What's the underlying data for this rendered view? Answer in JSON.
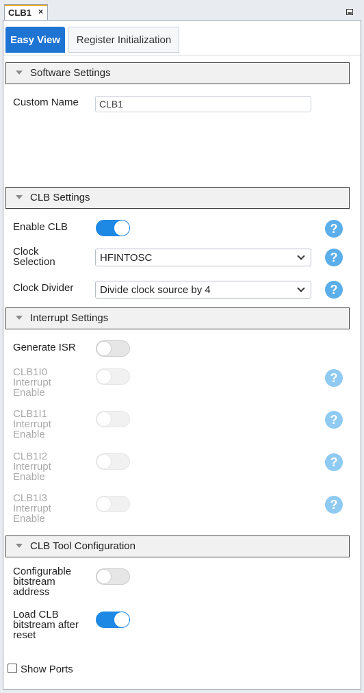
{
  "window": {
    "tab_title": "CLB1",
    "tab_close": "×"
  },
  "subtabs": {
    "easy_view": "Easy View",
    "register_init": "Register Initialization"
  },
  "software_settings": {
    "header": "Software Settings",
    "custom_name_label": "Custom Name",
    "custom_name_value": "CLB1"
  },
  "clb_settings": {
    "header": "CLB Settings",
    "enable_clb": {
      "label": "Enable CLB",
      "on": true
    },
    "clock_selection": {
      "label": "Clock\nSelection",
      "value": "HFINTOSC"
    },
    "clock_divider": {
      "label": "Clock Divider",
      "value": "Divide clock source by 4"
    }
  },
  "interrupt_settings": {
    "header": "Interrupt Settings",
    "generate_isr": {
      "label": "Generate ISR",
      "on": false
    },
    "items": [
      {
        "label": "CLB1I0\nInterrupt\nEnable",
        "on": false,
        "disabled": true
      },
      {
        "label": "CLB1I1\nInterrupt\nEnable",
        "on": false,
        "disabled": true
      },
      {
        "label": "CLB1I2\nInterrupt\nEnable",
        "on": false,
        "disabled": true
      },
      {
        "label": "CLB1I3\nInterrupt\nEnable",
        "on": false,
        "disabled": true
      }
    ]
  },
  "clb_tool_configuration": {
    "header": "CLB Tool Configuration",
    "configurable_bitstream": {
      "label": "Configurable\nbitstream\naddress",
      "on": false
    },
    "load_bitstream": {
      "label": "Load CLB\nbitstream after\nreset",
      "on": true
    }
  },
  "show_ports": {
    "label": "Show Ports",
    "checked": false
  },
  "icons": {
    "help": "?"
  },
  "colors": {
    "accent": "#1e74d2",
    "toggle_on": "#1e88e5",
    "help_icon": "#5aaeea",
    "tab_highlight": "#f0b020"
  }
}
